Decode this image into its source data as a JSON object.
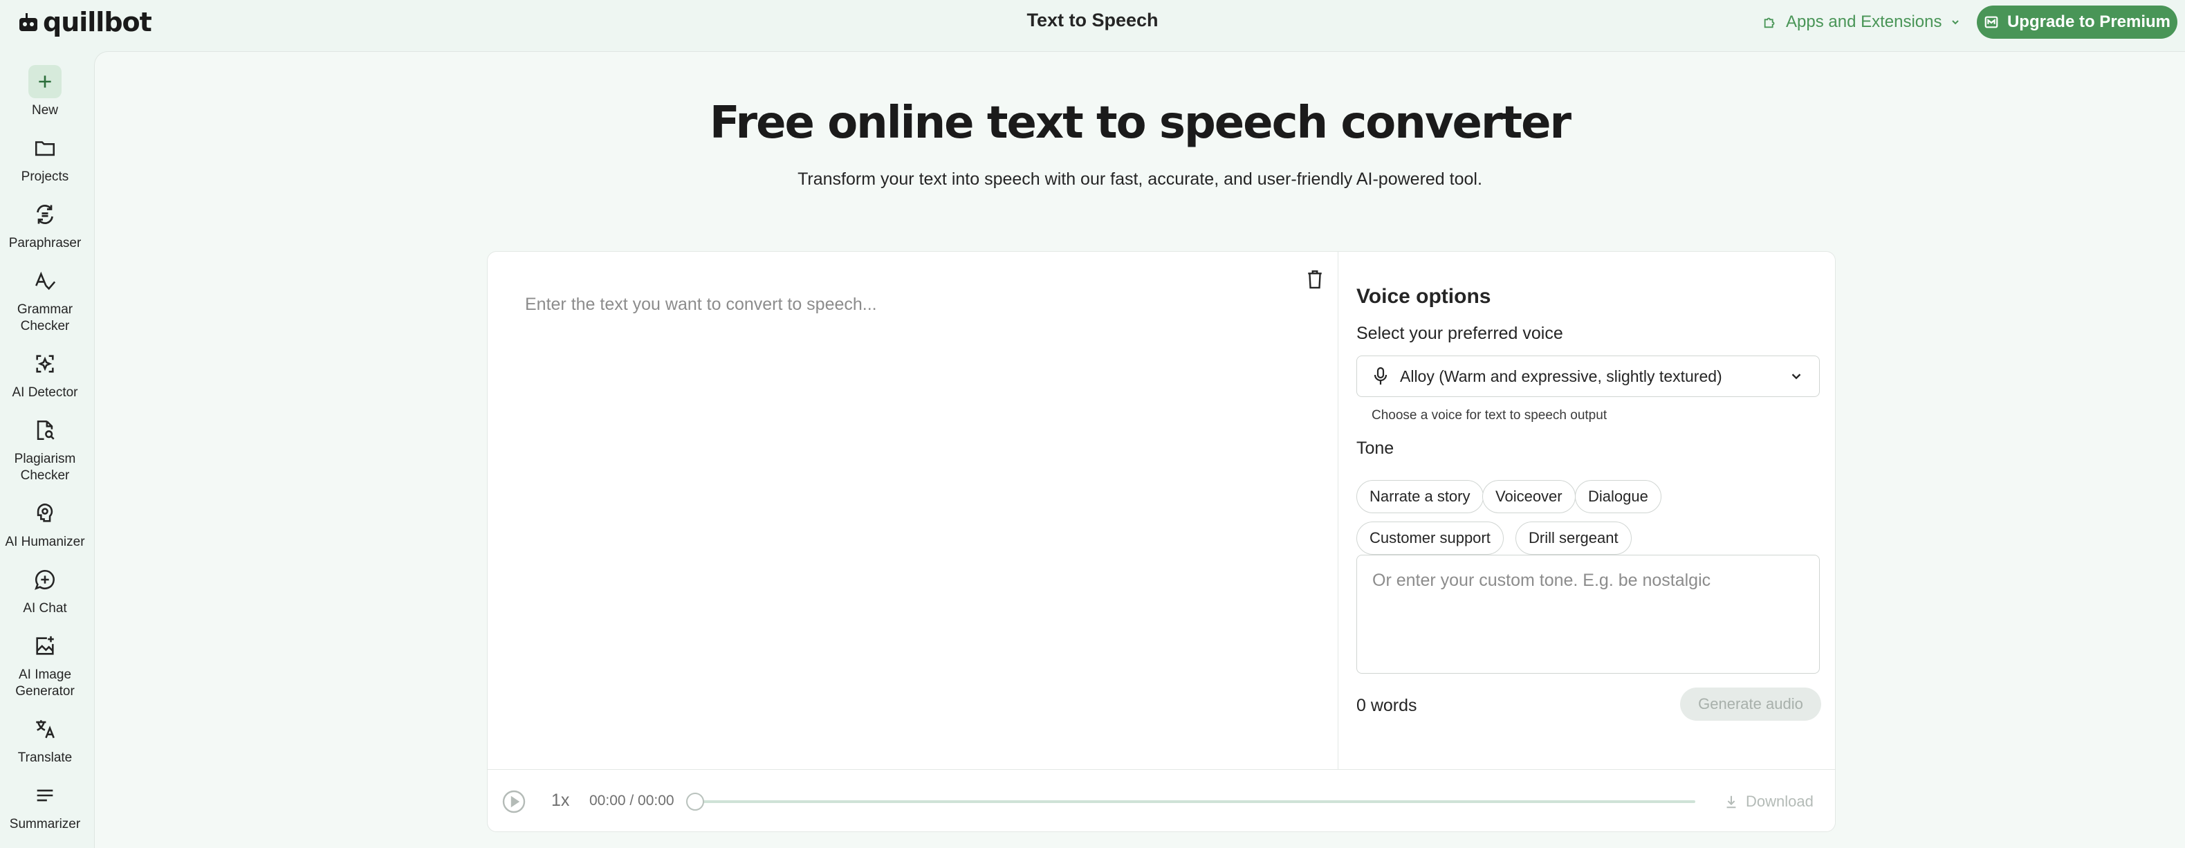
{
  "app": {
    "brand": "quillbot",
    "page_heading": "Text to Speech"
  },
  "header": {
    "apps_extensions_label": "Apps and Extensions",
    "upgrade_label": "Upgrade to Premium"
  },
  "sidebar": {
    "items": [
      {
        "label": "New",
        "icon": "plus-icon"
      },
      {
        "label": "Projects",
        "icon": "folder-icon"
      },
      {
        "label": "Paraphraser",
        "icon": "paraphraser-icon"
      },
      {
        "label": "Grammar\nChecker",
        "icon": "grammar-icon"
      },
      {
        "label": "AI Detector",
        "icon": "ai-detector-icon"
      },
      {
        "label": "Plagiarism\nChecker",
        "icon": "plagiarism-icon"
      },
      {
        "label": "AI Humanizer",
        "icon": "humanizer-icon"
      },
      {
        "label": "AI Chat",
        "icon": "chat-icon"
      },
      {
        "label": "AI Image\nGenerator",
        "icon": "image-generator-icon"
      },
      {
        "label": "Translate",
        "icon": "translate-icon"
      },
      {
        "label": "Summarizer",
        "icon": "summarizer-icon"
      }
    ]
  },
  "hero": {
    "title": "Free online text to speech converter",
    "subtitle": "Transform your text into speech with our fast, accurate, and user-friendly AI-powered tool."
  },
  "editor": {
    "placeholder": "Enter the text you want to convert to speech..."
  },
  "voice_options": {
    "title": "Voice options",
    "select_label": "Select your preferred voice",
    "selected_voice": "Alloy (Warm and expressive, slightly textured)",
    "help_text": "Choose a voice for text to speech output",
    "tone_label": "Tone",
    "tones": [
      "Narrate a story",
      "Voiceover",
      "Dialogue",
      "Customer support",
      "Drill sergeant"
    ],
    "custom_tone_placeholder": "Or enter your custom tone. E.g. be nostalgic",
    "word_count": "0 words",
    "generate_label": "Generate audio"
  },
  "player": {
    "speed": "1x",
    "time": "00:00 / 00:00",
    "download_label": "Download",
    "progress": 0
  },
  "colors": {
    "brand_green": "#499557",
    "background": "#eef6f2"
  }
}
